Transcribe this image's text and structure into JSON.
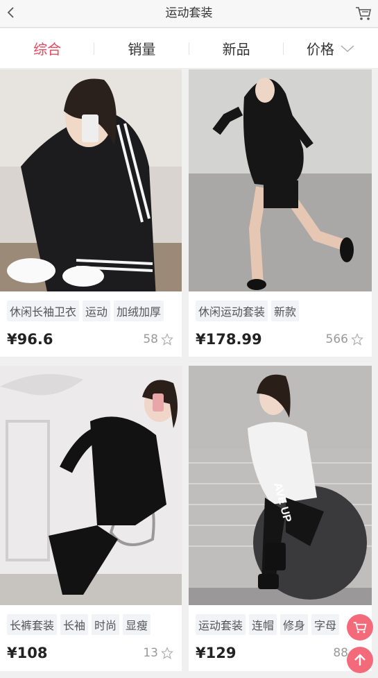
{
  "header": {
    "title": "运动套装"
  },
  "sort": {
    "tabs": [
      "综合",
      "销量",
      "新品",
      "价格"
    ]
  },
  "products": [
    {
      "tags": [
        "休闲长袖卫衣",
        "运动",
        "加绒加厚"
      ],
      "price": "¥96.6",
      "likes": "58"
    },
    {
      "tags": [
        "休闲运动套装",
        "新款"
      ],
      "price": "¥178.99",
      "likes": "566"
    },
    {
      "tags": [
        "长裤套装",
        "长袖",
        "时尚",
        "显瘦"
      ],
      "price": "¥108",
      "likes": "13"
    },
    {
      "tags": [
        "运动套装",
        "连帽",
        "修身",
        "字母"
      ],
      "price": "¥129",
      "likes": "88"
    }
  ],
  "colors": {
    "accent": "#e8475c",
    "fab": "#f36a7b"
  }
}
